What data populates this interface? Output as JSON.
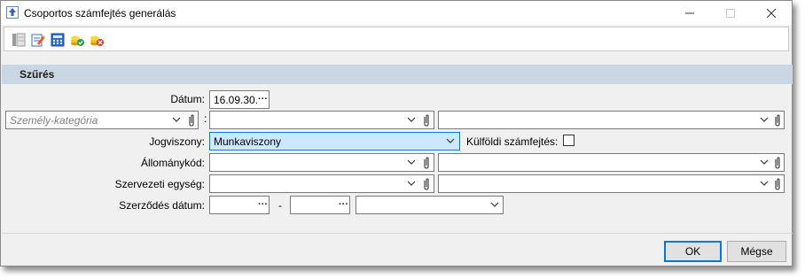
{
  "window": {
    "title": "Csoportos számfejtés generálás",
    "controls": {
      "minimize": "—",
      "maximize": "☐",
      "close": "✕"
    }
  },
  "toolbar": {
    "icons": [
      "columns-icon",
      "edit-document-icon",
      "calculator-icon",
      "coins-stack-icon",
      "coins-delete-icon"
    ]
  },
  "section": {
    "title": "Szűrés"
  },
  "form": {
    "datum_label": "Dátum:",
    "datum_value": "16.09.30.",
    "szemely_kategoria_placeholder": "Személy-kategória",
    "szemely_separator": ":",
    "jogviszony_label": "Jogviszony:",
    "jogviszony_value": "Munkaviszony",
    "kulfoldi_label": "Külföldi számfejtés:",
    "kulfoldi_checked": false,
    "allomanykod_label": "Állománykód:",
    "szervezeti_label": "Szervezeti egység:",
    "szerzodes_label": "Szerződés dátum:",
    "szerzodes_dash": "-"
  },
  "buttons": {
    "ok": "OK",
    "cancel": "Mégse"
  },
  "colors": {
    "section_bg": "#c9d7e5",
    "selected_bg": "#cce8ff",
    "accent": "#0078d7"
  }
}
